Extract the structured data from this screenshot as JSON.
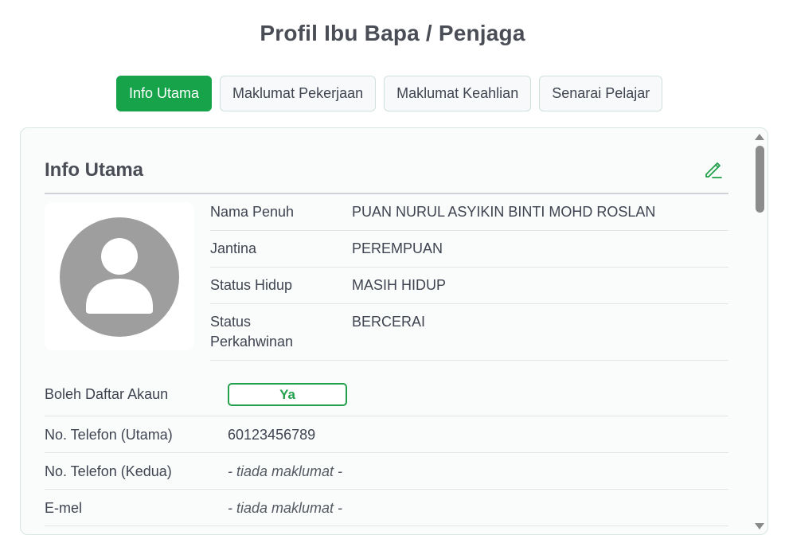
{
  "page": {
    "title": "Profil Ibu Bapa / Penjaga"
  },
  "tabs": [
    {
      "label": "Info Utama",
      "active": true
    },
    {
      "label": "Maklumat Pekerjaan",
      "active": false
    },
    {
      "label": "Maklumat Keahlian",
      "active": false
    },
    {
      "label": "Senarai Pelajar",
      "active": false
    }
  ],
  "section": {
    "title": "Info Utama",
    "edit_icon": "pencil-edit-icon",
    "avatar_icon": "user-avatar-icon"
  },
  "profile": [
    {
      "label": "Nama Penuh",
      "value": "PUAN NURUL ASYIKIN BINTI MOHD ROSLAN"
    },
    {
      "label": "Jantina",
      "value": "PEREMPUAN"
    },
    {
      "label": "Status Hidup",
      "value": "MASIH HIDUP"
    },
    {
      "label": "Status Perkahwinan",
      "value": "BERCERAI"
    }
  ],
  "details": [
    {
      "label": "Boleh Daftar Akaun",
      "value": "Ya",
      "type": "badge"
    },
    {
      "label": "No. Telefon (Utama)",
      "value": "60123456789",
      "type": "text"
    },
    {
      "label": "No. Telefon (Kedua)",
      "value": "- tiada maklumat -",
      "type": "empty"
    },
    {
      "label": "E-mel",
      "value": "- tiada maklumat -",
      "type": "empty"
    }
  ],
  "colors": {
    "accent": "#16a34a",
    "badge_border": "#22a04b",
    "text": "#3f4450",
    "avatar": "#9e9e9e"
  }
}
